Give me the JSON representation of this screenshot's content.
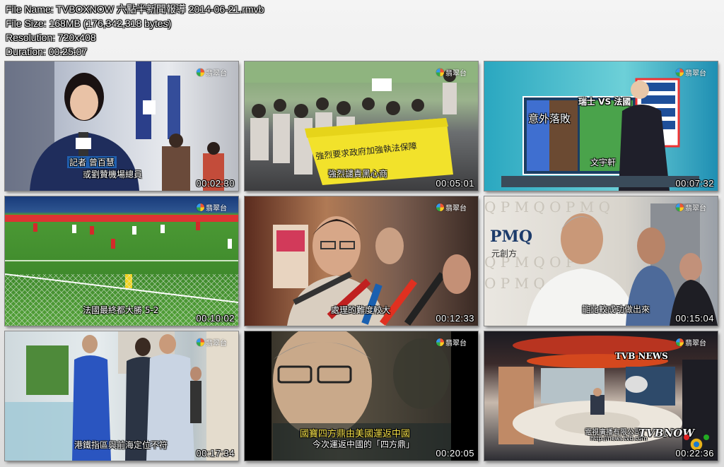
{
  "info": {
    "file_name": "File Name: TVBOXNOW 六點半新聞報導 2014-06-21.rmvb",
    "file_size": "File Size: 168MB (176,342,318 bytes)",
    "resolution": "Resolution: 720x408",
    "duration": "Duration: 00:25:07"
  },
  "channel_logo": "翡翠台",
  "thumbnails": [
    {
      "time": "00:02:30",
      "captions": [
        "記者 曾百慧",
        "或劉贊機場總員"
      ]
    },
    {
      "time": "00:05:01",
      "captions": [
        "強烈要求政府加強執法保障",
        "強烈譴責黑心商"
      ]
    },
    {
      "time": "00:07:32",
      "captions": [
        "瑞士 VS 法國",
        "意外落敗",
        "文宇軒"
      ]
    },
    {
      "time": "00:10:02",
      "captions": [
        "法國最終都大勝 5-2"
      ]
    },
    {
      "time": "00:12:33",
      "captions": [
        "處理的難度較大"
      ]
    },
    {
      "time": "00:15:04",
      "captions": [
        "PMQ",
        "元創方",
        "能比較成功做出來"
      ]
    },
    {
      "time": "00:17:34",
      "captions": [
        "港鐵指區與前海定位不符"
      ]
    },
    {
      "time": "00:20:05",
      "captions": [
        "國寶四方鼎由美國運返中國",
        "今次運返中國的「四方鼎」"
      ]
    },
    {
      "time": "00:22:36",
      "captions": [
        "TVB NEWS",
        "電視廣播有限公司",
        "http://news.tvb.com",
        "TVBNOW"
      ]
    }
  ]
}
